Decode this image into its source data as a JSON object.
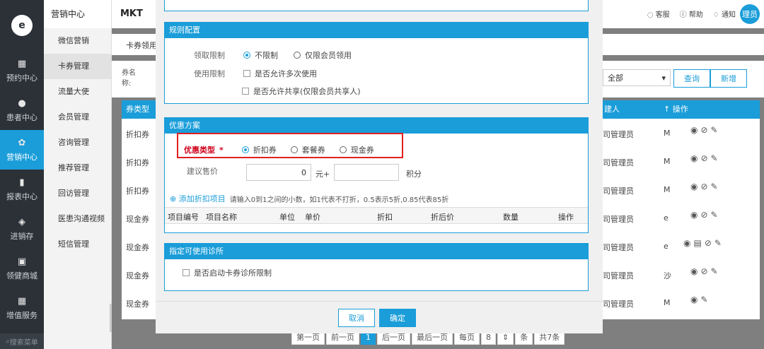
{
  "nav": {
    "items": [
      {
        "icon": "calendar-icon",
        "glyph": "▦",
        "label": "预约中心"
      },
      {
        "icon": "user-icon",
        "glyph": "●",
        "label": "患者中心"
      },
      {
        "icon": "fan-icon",
        "glyph": "✿",
        "label": "营销中心"
      },
      {
        "icon": "bar-chart-icon",
        "glyph": "▮",
        "label": "报表中心"
      },
      {
        "icon": "layers-icon",
        "glyph": "◈",
        "label": "进销存"
      },
      {
        "icon": "cart-icon",
        "glyph": "▣",
        "label": "领健商城"
      },
      {
        "icon": "grid-icon",
        "glyph": "▦",
        "label": "增值服务"
      }
    ],
    "search": "搜索菜单"
  },
  "subnav": {
    "title": "营销中心",
    "items": [
      "微信营销",
      "卡券管理",
      "流量大使",
      "会员管理",
      "咨询管理",
      "推荐管理",
      "回访管理",
      "医患沟通视频",
      "短信管理"
    ]
  },
  "topbar": {
    "title": "MKT",
    "links": [
      "客服",
      "帮助",
      "通知"
    ],
    "avatar": "理员"
  },
  "toolbar": {
    "tab": "卡券领用",
    "label_name": "券名称:",
    "select": "全部",
    "query": "查询",
    "add": "新增"
  },
  "table": {
    "headers": [
      "券类型",
      "建人",
      "操作"
    ],
    "rows": [
      {
        "type": "折扣券",
        "creator": "司管理员",
        "m": "M"
      },
      {
        "type": "折扣券",
        "creator": "司管理员",
        "m": "M"
      },
      {
        "type": "折扣券",
        "creator": "司管理员",
        "m": "M"
      },
      {
        "type": "现金券",
        "creator": "司管理员",
        "m": "e"
      },
      {
        "type": "现金券",
        "creator": "司管理员",
        "m": "e"
      },
      {
        "type": "现金券",
        "creator": "司管理员",
        "m": "沙"
      },
      {
        "type": "现金券",
        "creator": "司管理员",
        "m": "M"
      }
    ]
  },
  "pager": {
    "first": "第一页",
    "prev": "前一页",
    "cur": "1",
    "next": "后一页",
    "last": "最后一页",
    "per": "每页",
    "size": "8",
    "unit": "条",
    "total": "共7条"
  },
  "modal": {
    "rules": {
      "title": "规则配置",
      "claim_label": "领取限制",
      "opt1": "不限制",
      "opt2": "仅限会员领用",
      "use_label": "使用限制",
      "chk1": "是否允许多次使用",
      "chk2": "是否允许共享(仅限会员共享人)"
    },
    "plan": {
      "title": "优惠方案",
      "type_label": "优惠类型",
      "req": "*",
      "t1": "折扣券",
      "t2": "套餐券",
      "t3": "现金券",
      "price_label": "建议售价",
      "price": "0",
      "yuan": "元+",
      "points": "积分",
      "add": "添加折扣项目",
      "hint": "请输入0到1之间的小数，如1代表不打折，0.5表示5折,0.85代表85折",
      "cols": [
        "项目编号",
        "项目名称",
        "单位",
        "单价",
        "折扣",
        "折后价",
        "数量",
        "操作"
      ]
    },
    "clinic": {
      "title": "指定可使用诊所",
      "chk": "是否启动卡券诊所限制"
    },
    "cancel": "取消",
    "ok": "确定"
  }
}
